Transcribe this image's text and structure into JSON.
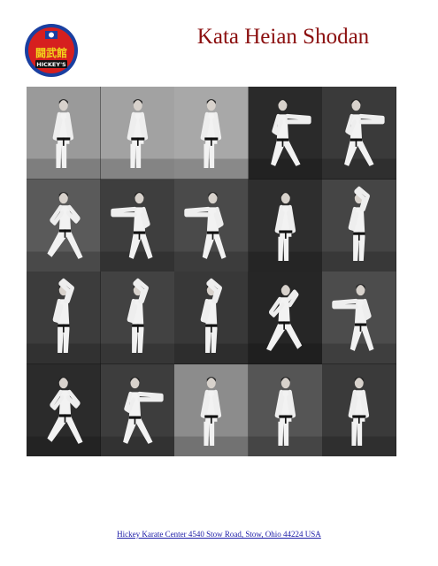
{
  "header": {
    "title": "Kata Heian Shodan",
    "logo": {
      "kanji": "闘武館",
      "text": "HICKEY'S",
      "colors": {
        "ring": "#1a3fa0",
        "fill": "#d61f1f",
        "band": "#111111",
        "kanji": "#f2d51b"
      }
    }
  },
  "photo_grid": {
    "rows": 4,
    "columns": 5,
    "cells": [
      {
        "bg": "#9a9a9a",
        "pose": "stand"
      },
      {
        "bg": "#a2a2a2",
        "pose": "stand"
      },
      {
        "bg": "#a8a8a8",
        "pose": "stand"
      },
      {
        "bg": "#2a2a2a",
        "pose": "punch-right"
      },
      {
        "bg": "#3a3a3a",
        "pose": "punch-right"
      },
      {
        "bg": "#5a5a5a",
        "pose": "lunge-left"
      },
      {
        "bg": "#3e3e3e",
        "pose": "punch-left"
      },
      {
        "bg": "#4a4a4a",
        "pose": "punch-left"
      },
      {
        "bg": "#2e2e2e",
        "pose": "stand"
      },
      {
        "bg": "#454545",
        "pose": "block-up"
      },
      {
        "bg": "#3c3c3c",
        "pose": "block-up"
      },
      {
        "bg": "#424242",
        "pose": "block-up"
      },
      {
        "bg": "#383838",
        "pose": "block-up"
      },
      {
        "bg": "#262626",
        "pose": "lunge-right"
      },
      {
        "bg": "#4c4c4c",
        "pose": "punch-left"
      },
      {
        "bg": "#2b2b2b",
        "pose": "lunge-left"
      },
      {
        "bg": "#3d3d3d",
        "pose": "punch-right"
      },
      {
        "bg": "#8c8c8c",
        "pose": "stand"
      },
      {
        "bg": "#555555",
        "pose": "stand"
      },
      {
        "bg": "#3a3a3a",
        "pose": "stand"
      }
    ]
  },
  "footer": {
    "link_text": "Hickey Karate Center 4540 Stow Road, Stow, Ohio 44224 USA"
  }
}
